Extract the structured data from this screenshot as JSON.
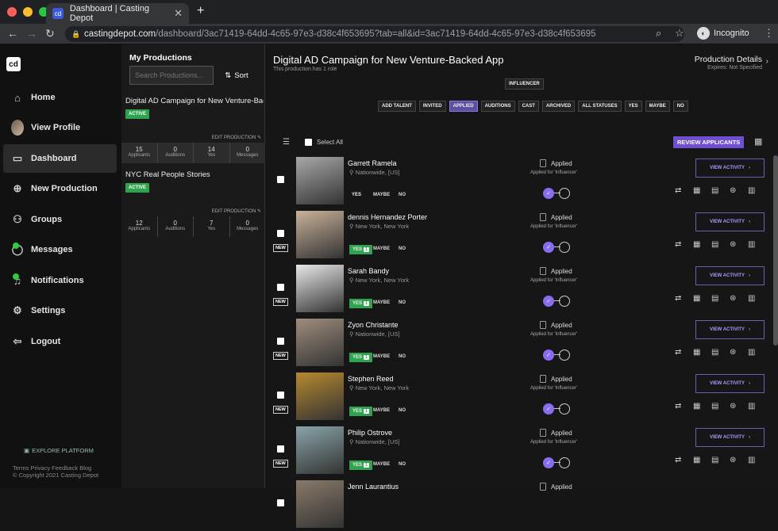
{
  "browser": {
    "tab_title": "Dashboard | Casting Depot",
    "url_host": "castingdepot.com",
    "url_path": "/dashboard/3ac71419-64dd-4c65-97e3-d38c4f653695?tab=all&id=3ac71419-64dd-4c65-97e3-d38c4f653695",
    "profile": "Incognito"
  },
  "nav": {
    "logo": "cd",
    "items": [
      "Home",
      "View Profile",
      "Dashboard",
      "New Production",
      "Groups",
      "Messages",
      "Notifications",
      "Settings",
      "Logout"
    ],
    "active": "Dashboard",
    "explore": "EXPLORE PLATFORM",
    "footer_links": "Terms  Privacy  Feedback  Blog",
    "copyright": "© Copyright 2021 Casting Depot"
  },
  "productions": {
    "heading": "My Productions",
    "search_placeholder": "Search Productions...",
    "sort_label": "Sort",
    "list": [
      {
        "title": "Digital AD Campaign for New Venture-Backed App",
        "status": "ACTIVE",
        "edit": "EDIT PRODUCTION",
        "stats": [
          {
            "n": "15",
            "l": "Applicants"
          },
          {
            "n": "0",
            "l": "Auditions"
          },
          {
            "n": "14",
            "l": "Yes"
          },
          {
            "n": "0",
            "l": "Messages"
          }
        ]
      },
      {
        "title": "NYC Real People Stories",
        "status": "ACTIVE",
        "edit": "EDIT PRODUCTION",
        "stats": [
          {
            "n": "12",
            "l": "Applicants"
          },
          {
            "n": "0",
            "l": "Auditions"
          },
          {
            "n": "7",
            "l": "Yes"
          },
          {
            "n": "0",
            "l": "Messages"
          }
        ]
      }
    ]
  },
  "main": {
    "title": "Digital AD Campaign for New Venture-Backed App",
    "subtitle": "This production has 1 role",
    "details_label": "Production Details",
    "expires": "Expires: Not Specified",
    "role": "INFLUENCER",
    "filters": [
      "ADD TALENT",
      "INVITED",
      "APPLIED",
      "AUDITIONS",
      "CAST",
      "ARCHIVED",
      "ALL STATUSES",
      "YES",
      "MAYBE",
      "NO"
    ],
    "active_filter": "APPLIED",
    "select_all": "Select All",
    "review_btn": "REVIEW APPLICANTS",
    "applicants": [
      {
        "name": "Garrett Ramela",
        "loc": "Nationwide, [US]",
        "new": "",
        "yes": "YES",
        "yes_count": "",
        "status": "Applied",
        "for": "Applied for 'Influencer'",
        "view": "VIEW ACTIVITY",
        "photo": "#a8a8a8"
      },
      {
        "name": "dennis Hernandez Porter",
        "loc": "New York, New York",
        "new": "NEW",
        "yes": "YES",
        "yes_count": "1",
        "status": "Applied",
        "for": "Applied for 'Influencer'",
        "view": "VIEW ACTIVITY",
        "photo": "#c9b29a"
      },
      {
        "name": "Sarah Bandy",
        "loc": "New York, New York",
        "new": "NEW",
        "yes": "YES",
        "yes_count": "1",
        "status": "Applied",
        "for": "Applied for 'Influencer'",
        "view": "VIEW ACTIVITY",
        "photo": "#e8e8e8"
      },
      {
        "name": "Zyon Christante",
        "loc": "Nationwide, [US]",
        "new": "NEW",
        "yes": "YES",
        "yes_count": "1",
        "status": "Applied",
        "for": "Applied for 'Influencer'",
        "view": "VIEW ACTIVITY",
        "photo": "#9f8d7d"
      },
      {
        "name": "Stephen Reed",
        "loc": "New York, New York",
        "new": "NEW",
        "yes": "YES",
        "yes_count": "1",
        "status": "Applied",
        "for": "Applied for 'Influencer'",
        "view": "VIEW ACTIVITY",
        "photo": "#b7892f"
      },
      {
        "name": "Philip Ostrove",
        "loc": "Nationwide, [US]",
        "new": "NEW",
        "yes": "YES",
        "yes_count": "1",
        "status": "Applied",
        "for": "Applied for 'Influencer'",
        "view": "VIEW ACTIVITY",
        "photo": "#8aa4a8"
      },
      {
        "name": "Jenn Laurantius",
        "loc": "",
        "new": "",
        "yes": "",
        "yes_count": "",
        "status": "Applied",
        "for": "",
        "view": "",
        "photo": "#8a7a6a"
      }
    ],
    "maybe": "MAYBE",
    "no": "NO"
  }
}
